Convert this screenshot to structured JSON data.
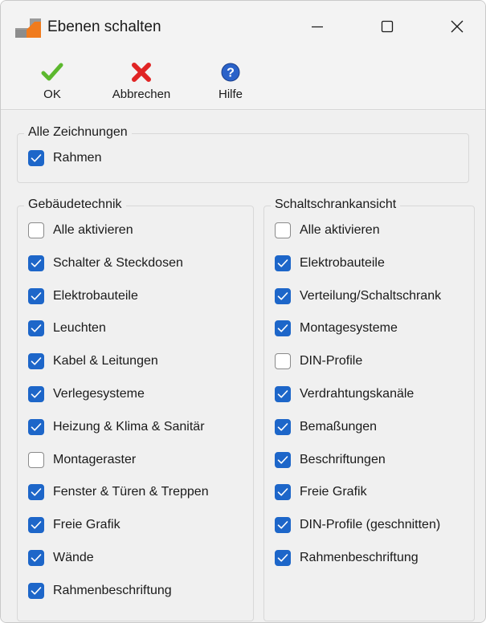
{
  "window": {
    "title": "Ebenen schalten",
    "icons": {
      "app": "app-logo-icon",
      "minimize": "minimize-icon",
      "maximize": "maximize-icon",
      "close": "close-icon"
    }
  },
  "toolbar": {
    "ok_label": "OK",
    "cancel_label": "Abbrechen",
    "help_label": "Hilfe",
    "icons": {
      "ok": "checkmark-icon",
      "cancel": "red-x-icon",
      "help": "help-question-icon"
    },
    "colors": {
      "ok": "#5cb82e",
      "cancel": "#e02424",
      "help": "#2a62c9"
    }
  },
  "groups": {
    "all_drawings": {
      "legend": "Alle Zeichnungen",
      "items": [
        {
          "label": "Rahmen",
          "checked": true
        }
      ]
    },
    "gebaeudetechnik": {
      "legend": "Gebäudetechnik",
      "items": [
        {
          "label": "Alle aktivieren",
          "checked": false
        },
        {
          "label": "Schalter & Steckdosen",
          "checked": true
        },
        {
          "label": "Elektrobauteile",
          "checked": true
        },
        {
          "label": "Leuchten",
          "checked": true
        },
        {
          "label": "Kabel & Leitungen",
          "checked": true
        },
        {
          "label": "Verlegesysteme",
          "checked": true
        },
        {
          "label": "Heizung & Klima & Sanitär",
          "checked": true
        },
        {
          "label": "Montageraster",
          "checked": false
        },
        {
          "label": "Fenster & Türen & Treppen",
          "checked": true
        },
        {
          "label": "Freie Grafik",
          "checked": true
        },
        {
          "label": "Wände",
          "checked": true
        },
        {
          "label": "Rahmenbeschriftung",
          "checked": true
        }
      ]
    },
    "schaltschrankansicht": {
      "legend": "Schaltschrankansicht",
      "items": [
        {
          "label": "Alle aktivieren",
          "checked": false
        },
        {
          "label": "Elektrobauteile",
          "checked": true
        },
        {
          "label": "Verteilung/Schaltschrank",
          "checked": true
        },
        {
          "label": "Montagesysteme",
          "checked": true
        },
        {
          "label": "DIN-Profile",
          "checked": false
        },
        {
          "label": "Verdrahtungskanäle",
          "checked": true
        },
        {
          "label": "Bemaßungen",
          "checked": true
        },
        {
          "label": "Beschriftungen",
          "checked": true
        },
        {
          "label": "Freie Grafik",
          "checked": true
        },
        {
          "label": "DIN-Profile (geschnitten)",
          "checked": true
        },
        {
          "label": "Rahmenbeschriftung",
          "checked": true
        }
      ]
    }
  },
  "colors": {
    "checkbox_checked": "#1d66c9",
    "checkbox_unchecked_border": "#8a8a8a"
  }
}
